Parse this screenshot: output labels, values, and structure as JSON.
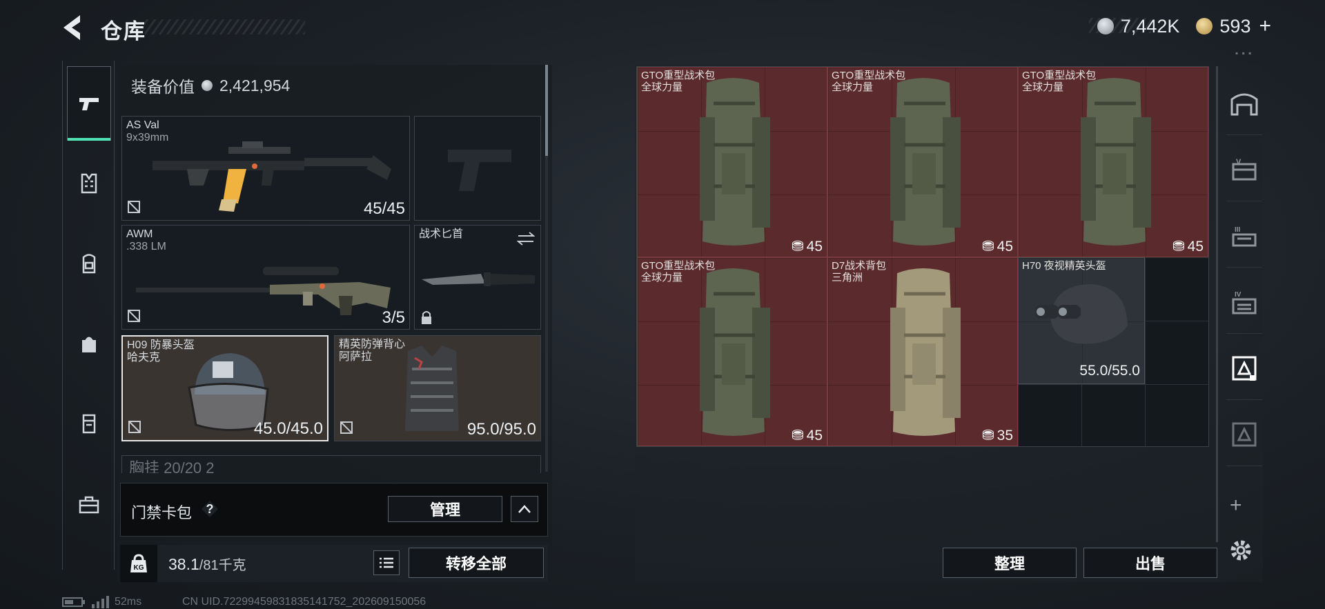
{
  "header": {
    "title": "仓库",
    "silver_amount": "7,442K",
    "gold_amount": "593"
  },
  "equipment": {
    "value_label": "装备价值",
    "value": "2,421,954",
    "primary_weapon": {
      "name": "AS Val",
      "caliber": "9x39mm",
      "ammo": "45/45"
    },
    "secondary_weapon": {
      "name": "AWM",
      "caliber": ".338 LM",
      "ammo": "3/5"
    },
    "melee": {
      "name": "战术匕首"
    },
    "helmet": {
      "name": "H09 防暴头盔",
      "map": "哈夫克",
      "durability": "45.0/45.0"
    },
    "armor": {
      "name": "精英防弹背心",
      "map": "阿萨拉",
      "durability": "95.0/95.0"
    },
    "chest_rig_partial": "胸挂 20/20 2"
  },
  "card_bar": {
    "label": "门禁卡包",
    "help": "?",
    "manage_label": "管理"
  },
  "weight": {
    "current": "38.1",
    "max": "/81千克",
    "kg_icon": "KG",
    "transfer_label": "转移全部"
  },
  "status": {
    "ping": "52ms",
    "uid": "CN UID.72299459831835141752_202609150056"
  },
  "storage": {
    "items": [
      {
        "name": "GTO重型战术包",
        "sub": "全球力量",
        "capacity": "45"
      },
      {
        "name": "GTO重型战术包",
        "sub": "全球力量",
        "capacity": "45"
      },
      {
        "name": "GTO重型战术包",
        "sub": "全球力量",
        "capacity": "45"
      },
      {
        "name": "GTO重型战术包",
        "sub": "全球力量",
        "capacity": "45"
      },
      {
        "name": "D7战术背包",
        "sub": "三角洲",
        "capacity": "35"
      },
      {
        "name": "H70 夜视精英头盔",
        "sub": "",
        "durability": "55.0/55.0"
      }
    ],
    "sort_label": "整理",
    "sell_label": "出售"
  },
  "right_tabs": {
    "tab_labels": [
      "",
      "V",
      "III",
      "IV",
      "",
      ""
    ],
    "add_label": "+"
  },
  "colors": {
    "accent": "#4fe3b3",
    "item_bg": "#5a2a2c",
    "slot_bg": "#161c22"
  }
}
